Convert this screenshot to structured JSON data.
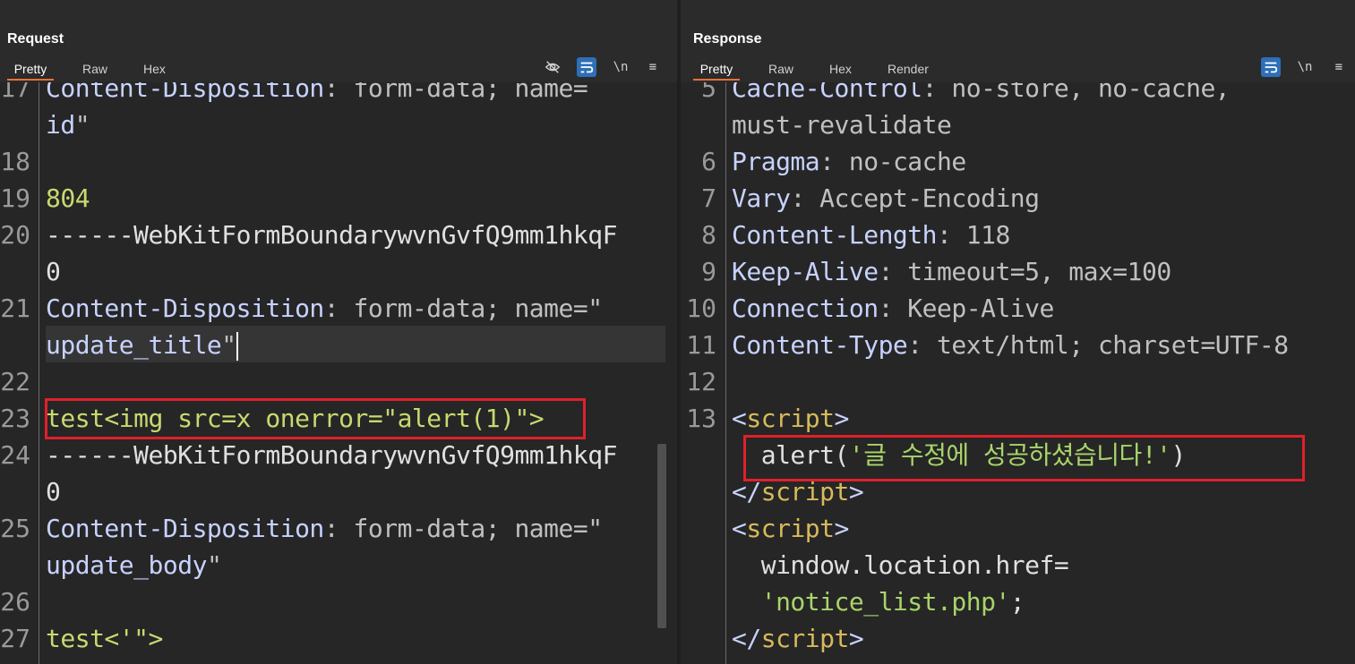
{
  "request": {
    "title": "Request",
    "tabs": [
      "Pretty",
      "Raw",
      "Hex"
    ],
    "active_tab": "Pretty",
    "tools": {
      "hide_icon": "eye-slash-icon",
      "wrap_icon": "wrap-icon",
      "newline": "\\n",
      "menu": "≡"
    },
    "lines": [
      {
        "num": "17",
        "parts": [
          [
            "k",
            "Content-Disposition"
          ],
          [
            "v",
            ": form-data; name="
          ]
        ]
      },
      {
        "num": "",
        "parts": [
          [
            "k",
            "id"
          ],
          [
            "v",
            "\""
          ]
        ]
      },
      {
        "num": "18",
        "parts": []
      },
      {
        "num": "19",
        "parts": [
          [
            "g",
            "804"
          ]
        ]
      },
      {
        "num": "20",
        "parts": [
          [
            "w",
            "------WebKitFormBoundarywvnGvfQ9mm1hkqF"
          ]
        ]
      },
      {
        "num": "",
        "parts": [
          [
            "w",
            "0"
          ]
        ]
      },
      {
        "num": "21",
        "parts": [
          [
            "k",
            "Content-Disposition"
          ],
          [
            "v",
            ": form-data; name=\""
          ]
        ]
      },
      {
        "num": "",
        "parts": [
          [
            "k",
            "update_title"
          ],
          [
            "v",
            "\""
          ]
        ]
      },
      {
        "num": "22",
        "parts": []
      },
      {
        "num": "23",
        "parts": [
          [
            "g",
            "test<img src=x onerror=\"alert(1)\">"
          ]
        ]
      },
      {
        "num": "24",
        "parts": [
          [
            "w",
            "------WebKitFormBoundarywvnGvfQ9mm1hkqF"
          ]
        ]
      },
      {
        "num": "",
        "parts": [
          [
            "w",
            "0"
          ]
        ]
      },
      {
        "num": "25",
        "parts": [
          [
            "k",
            "Content-Disposition"
          ],
          [
            "v",
            ": form-data; name=\""
          ]
        ]
      },
      {
        "num": "",
        "parts": [
          [
            "k",
            "update_body"
          ],
          [
            "v",
            "\""
          ]
        ]
      },
      {
        "num": "26",
        "parts": []
      },
      {
        "num": "27",
        "parts": [
          [
            "g",
            "test<'\">"
          ]
        ]
      }
    ]
  },
  "response": {
    "title": "Response",
    "tabs": [
      "Pretty",
      "Raw",
      "Hex",
      "Render"
    ],
    "active_tab": "Pretty",
    "tools": {
      "wrap_icon": "wrap-icon",
      "newline": "\\n",
      "menu": "≡"
    },
    "lines": [
      {
        "num": "5",
        "parts": [
          [
            "k",
            "Cache-Control"
          ],
          [
            "v",
            ": no-store, no-cache,"
          ]
        ]
      },
      {
        "num": "",
        "parts": [
          [
            "v",
            "must-revalidate"
          ]
        ]
      },
      {
        "num": "6",
        "parts": [
          [
            "k",
            "Pragma"
          ],
          [
            "v",
            ": no-cache"
          ]
        ]
      },
      {
        "num": "7",
        "parts": [
          [
            "k",
            "Vary"
          ],
          [
            "v",
            ": Accept-Encoding"
          ]
        ]
      },
      {
        "num": "8",
        "parts": [
          [
            "k",
            "Content-Length"
          ],
          [
            "v",
            ": 118"
          ]
        ]
      },
      {
        "num": "9",
        "parts": [
          [
            "k",
            "Keep-Alive"
          ],
          [
            "v",
            ": timeout=5, max=100"
          ]
        ]
      },
      {
        "num": "10",
        "parts": [
          [
            "k",
            "Connection"
          ],
          [
            "v",
            ": Keep-Alive"
          ]
        ]
      },
      {
        "num": "11",
        "parts": [
          [
            "k",
            "Content-Type"
          ],
          [
            "v",
            ": text/html; charset=UTF-8"
          ]
        ]
      },
      {
        "num": "12",
        "parts": []
      },
      {
        "num": "13",
        "parts": [
          [
            "t",
            "<"
          ],
          [
            "o",
            "script"
          ],
          [
            "t",
            ">"
          ]
        ]
      },
      {
        "num": "",
        "parts": [
          [
            "w",
            "  alert("
          ],
          [
            "s",
            "'글 수정에 성공하셨습니다!'"
          ],
          [
            "w",
            ")"
          ]
        ]
      },
      {
        "num": "",
        "parts": [
          [
            "t",
            "</"
          ],
          [
            "o",
            "script"
          ],
          [
            "t",
            ">"
          ]
        ]
      },
      {
        "num": "",
        "parts": [
          [
            "t",
            "<"
          ],
          [
            "o",
            "script"
          ],
          [
            "t",
            ">"
          ]
        ]
      },
      {
        "num": "",
        "parts": [
          [
            "w",
            "  window.location.href="
          ]
        ]
      },
      {
        "num": "",
        "parts": [
          [
            "s",
            "  'notice_list.php'"
          ],
          [
            "w",
            ";"
          ]
        ]
      },
      {
        "num": "",
        "parts": [
          [
            "t",
            "</"
          ],
          [
            "o",
            "script"
          ],
          [
            "t",
            ">"
          ]
        ]
      }
    ]
  },
  "layout_switch": [
    "side-by-side-icon",
    "stacked-icon",
    "single-icon"
  ],
  "colors": {
    "accent": "#e8703a",
    "highlight": "#e0202a",
    "button_blue": "#2d6fb8"
  }
}
